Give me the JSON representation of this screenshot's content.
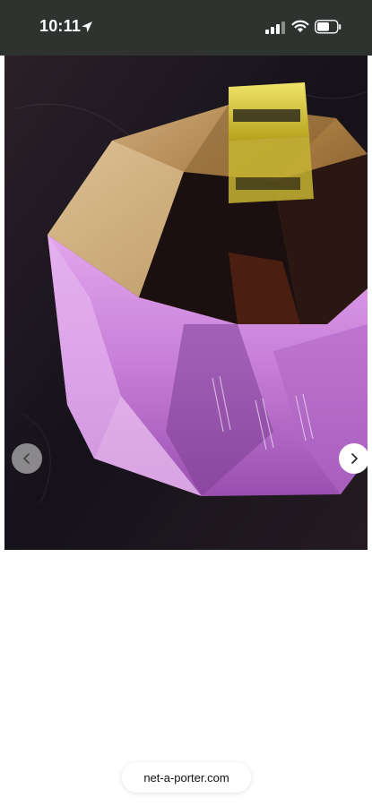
{
  "status_bar": {
    "time": "10:11",
    "icons": [
      "location-arrow-icon",
      "cellular-signal-icon",
      "wifi-icon",
      "battery-icon"
    ]
  },
  "gallery": {
    "image": "product-photo",
    "controls": [
      "chevron-left-icon",
      "chevron-right-icon"
    ]
  },
  "address_bar": {
    "url": "net-a-porter.com"
  },
  "colors": {
    "status_bar_bg": "#2f3330",
    "page_bg": "#ffffff",
    "crystal_pink": "#d98ee6",
    "crystal_amber": "#a8833f",
    "lid_knob_yellow": "#d8cf3c"
  }
}
